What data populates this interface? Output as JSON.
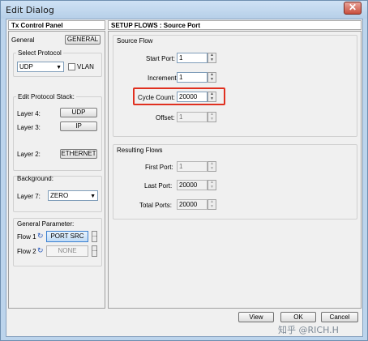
{
  "window": {
    "title": "Edit Dialog",
    "close_glyph": "✕"
  },
  "left": {
    "header": "Tx Control Panel",
    "general_label": "General",
    "general_button": "GENERAL",
    "select_protocol": {
      "title": "Select Protocol",
      "selected": "UDP",
      "vlan_label": "VLAN",
      "vlan_checked": false
    },
    "protocol_stack": {
      "title": "Edit Protocol Stack:",
      "layer4_label": "Layer 4:",
      "layer4_button": "UDP",
      "layer3_label": "Layer 3:",
      "layer3_button": "IP",
      "layer2_label": "Layer 2:",
      "layer2_button": "ETHERNET"
    },
    "background": {
      "title": "Background:",
      "layer7_label": "Layer 7:",
      "layer7_selected": "ZERO"
    },
    "general_param": {
      "title": "General Parameter:",
      "flow1_label": "Flow 1",
      "flow1_button": "PORT SRC",
      "flow2_label": "Flow 2",
      "flow2_button": "NONE",
      "ellipsis": "..."
    }
  },
  "right": {
    "header": "SETUP FLOWS : Source Port",
    "source_flow": {
      "title": "Source Flow",
      "start_port_label": "Start Port:",
      "start_port_value": "1",
      "increment_label": "Increment:",
      "increment_value": "1",
      "cycle_count_label": "Cycle Count:",
      "cycle_count_value": "20000",
      "offset_label": "Offset:",
      "offset_value": "1"
    },
    "resulting_flows": {
      "title": "Resulting Flows",
      "first_port_label": "First Port:",
      "first_port_value": "1",
      "last_port_label": "Last Port:",
      "last_port_value": "20000",
      "total_ports_label": "Total Ports:",
      "total_ports_value": "20000"
    }
  },
  "footer": {
    "view": "View",
    "ok": "OK",
    "cancel": "Cancel"
  },
  "watermark": "知乎 @RICH.H",
  "colors": {
    "highlight": "#e03020",
    "titlebar": "#bcd4ec"
  },
  "icons": {
    "dropdown": "▼",
    "spin_up": "▲",
    "spin_down": "▼",
    "flow": "↻"
  }
}
